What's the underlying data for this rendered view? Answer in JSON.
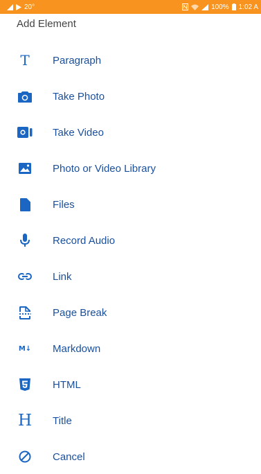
{
  "status_bar": {
    "left_text": "20°",
    "right_text": "100%",
    "time": "1:02 A",
    "background": "#f7931e"
  },
  "sheet": {
    "title": "Add Element"
  },
  "menu": {
    "accent_color": "#1a66c2",
    "items": [
      {
        "label": "Paragraph",
        "icon": "paragraph-T-icon",
        "glyph": "T"
      },
      {
        "label": "Take Photo",
        "icon": "camera-icon"
      },
      {
        "label": "Take Video",
        "icon": "video-camera-icon"
      },
      {
        "label": "Photo or Video Library",
        "icon": "photo-library-icon"
      },
      {
        "label": "Files",
        "icon": "file-icon"
      },
      {
        "label": "Record Audio",
        "icon": "microphone-icon"
      },
      {
        "label": "Link",
        "icon": "link-icon"
      },
      {
        "label": "Page Break",
        "icon": "page-break-icon"
      },
      {
        "label": "Markdown",
        "icon": "markdown-icon",
        "glyph": "M↓"
      },
      {
        "label": "HTML",
        "icon": "html5-icon"
      },
      {
        "label": "Title",
        "icon": "title-H-icon",
        "glyph": "H"
      },
      {
        "label": "Cancel",
        "icon": "cancel-icon"
      }
    ]
  }
}
